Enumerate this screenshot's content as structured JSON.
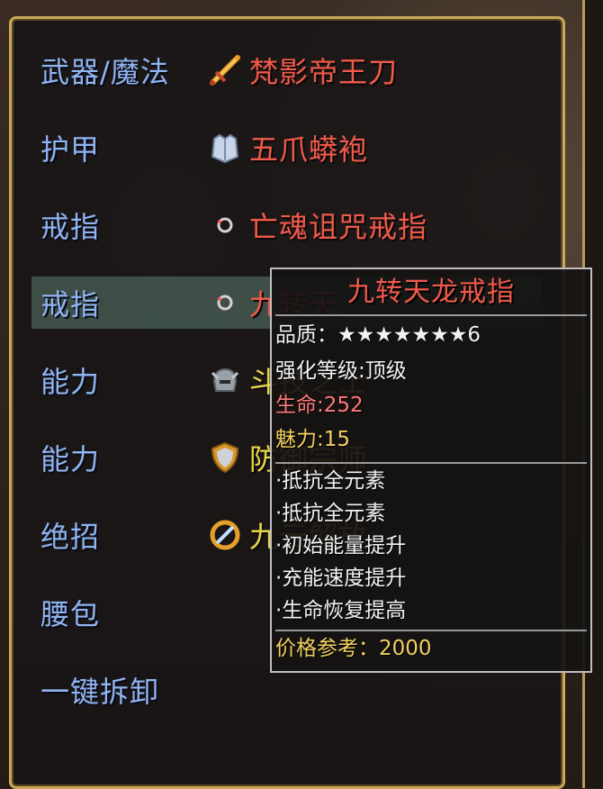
{
  "slots": [
    {
      "label": "武器/魔法",
      "item": "梵影帝王刀",
      "icon": "sword-icon",
      "color": "#f05a4a"
    },
    {
      "label": "护甲",
      "item": "五爪蟒袍",
      "icon": "armor-icon",
      "color": "#f05a4a"
    },
    {
      "label": "戒指",
      "item": "亡魂诅咒戒指",
      "icon": "ring-icon",
      "color": "#f05a4a"
    },
    {
      "label": "戒指",
      "item": "九转天龙戒指",
      "item_visible": "九转天",
      "icon": "ring-icon",
      "color": "#f05a4a"
    },
    {
      "label": "能力",
      "item": "斗技之士",
      "item_visible": "斗技之士",
      "icon": "helmet-icon",
      "color": "#e8d64a"
    },
    {
      "label": "能力",
      "item": "防御宗师",
      "item_visible": "防御宗师",
      "icon": "shield-icon",
      "color": "#e8d64a"
    },
    {
      "label": "绝招",
      "item": "九云解放",
      "item_visible": "九云解放",
      "icon": "skill-icon",
      "color": "#e8d64a"
    },
    {
      "label": "腰包",
      "item": "",
      "icon": "",
      "color": ""
    },
    {
      "label": "一键拆卸",
      "item": "",
      "icon": "",
      "color": ""
    }
  ],
  "tooltip": {
    "title": "九转天龙戒指",
    "quality_label": "品质：",
    "quality_stars": 7,
    "quality_level": "6",
    "enhance": "强化等级:顶级",
    "hp": "生命:252",
    "charm": "魅力:15",
    "effects": [
      "·抵抗全元素",
      "·抵抗全元素",
      "·初始能量提升",
      "·充能速度提升",
      "·生命恢复提高"
    ],
    "price": "价格参考：2000"
  },
  "colors": {
    "label_blue": "#8fb4f0",
    "item_red": "#f05a4a",
    "item_yellow": "#e8d64a",
    "frame_gold": "#c9a85a"
  }
}
